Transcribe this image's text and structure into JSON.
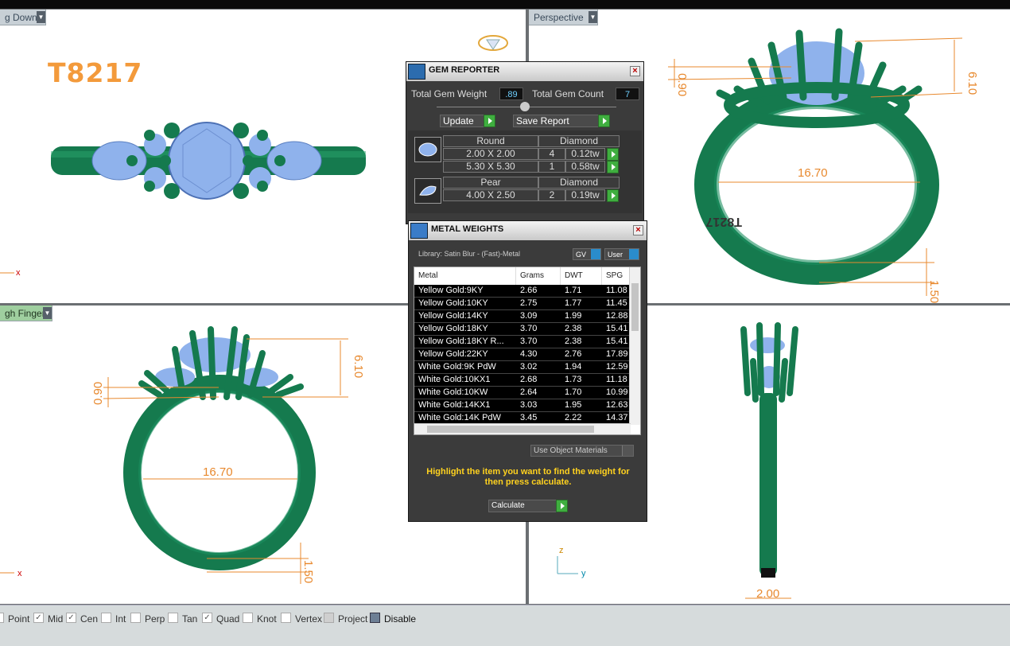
{
  "viewports": {
    "top_left": {
      "tab": "g Down",
      "title": "T8217"
    },
    "top_right": {
      "tab": "Perspective",
      "dim_main": "16.70",
      "dim_a": "6.10",
      "dim_b": "0.90",
      "dim_c": "1.50",
      "stamp": "T8217"
    },
    "bottom_left": {
      "tab": "gh Finger",
      "dim_main": "16.70",
      "dim_a": "6.10",
      "dim_b": "0.90",
      "dim_c": "1.50"
    },
    "bottom_right": {
      "dim_main": "2.00",
      "axis_z": "z",
      "axis_y": "y"
    }
  },
  "gem_reporter": {
    "title": "GEM REPORTER",
    "total_weight_label": "Total Gem Weight",
    "total_weight_value": ".89",
    "total_count_label": "Total Gem Count",
    "total_count_value": "7",
    "update_label": "Update",
    "save_report_label": "Save Report",
    "groups": [
      {
        "shape": "Round",
        "material": "Diamond",
        "rows": [
          {
            "size": "2.00 X 2.00",
            "count": "4",
            "tw": "0.12tw"
          },
          {
            "size": "5.30 X 5.30",
            "count": "1",
            "tw": "0.58tw"
          }
        ]
      },
      {
        "shape": "Pear",
        "material": "Diamond",
        "rows": [
          {
            "size": "4.00 X 2.50",
            "count": "2",
            "tw": "0.19tw"
          }
        ]
      }
    ]
  },
  "metal_weights": {
    "title": "METAL WEIGHTS",
    "library": "Library: Satin Blur - (Fast)-Metal",
    "gv_label": "GV",
    "user_label": "User",
    "columns": [
      "Metal",
      "Grams",
      "DWT",
      "SPG"
    ],
    "rows": [
      [
        "Yellow Gold:9KY",
        "2.66",
        "1.71",
        "11.08"
      ],
      [
        "Yellow Gold:10KY",
        "2.75",
        "1.77",
        "11.45"
      ],
      [
        "Yellow Gold:14KY",
        "3.09",
        "1.99",
        "12.88"
      ],
      [
        "Yellow Gold:18KY",
        "3.70",
        "2.38",
        "15.41"
      ],
      [
        "Yellow Gold:18KY R...",
        "3.70",
        "2.38",
        "15.41"
      ],
      [
        "Yellow Gold:22KY",
        "4.30",
        "2.76",
        "17.89"
      ],
      [
        "White Gold:9K PdW",
        "3.02",
        "1.94",
        "12.59"
      ],
      [
        "White Gold:10KX1",
        "2.68",
        "1.73",
        "11.18"
      ],
      [
        "White Gold:10KW",
        "2.64",
        "1.70",
        "10.99"
      ],
      [
        "White Gold:14KX1",
        "3.03",
        "1.95",
        "12.63"
      ],
      [
        "White Gold:14K PdW",
        "3.45",
        "2.22",
        "14.37"
      ]
    ],
    "use_object_materials": "Use Object Materials",
    "hint": "Highlight the item you want to find the weight for then press calculate.",
    "calculate_label": "Calculate"
  },
  "snaps": [
    {
      "label": "Point",
      "checked": false
    },
    {
      "label": "Mid",
      "checked": true
    },
    {
      "label": "Cen",
      "checked": true
    },
    {
      "label": "Int",
      "checked": false
    },
    {
      "label": "Perp",
      "checked": false
    },
    {
      "label": "Tan",
      "checked": false
    },
    {
      "label": "Quad",
      "checked": true
    },
    {
      "label": "Knot",
      "checked": false
    },
    {
      "label": "Vertex",
      "checked": false
    },
    {
      "label": "Project",
      "checked": false
    },
    {
      "label": "Disable",
      "checked": false
    }
  ],
  "colors": {
    "metal": "#157a4e",
    "gem": "#8fb2ec",
    "dimension": "#e8892e",
    "title": "#f39a3b"
  }
}
